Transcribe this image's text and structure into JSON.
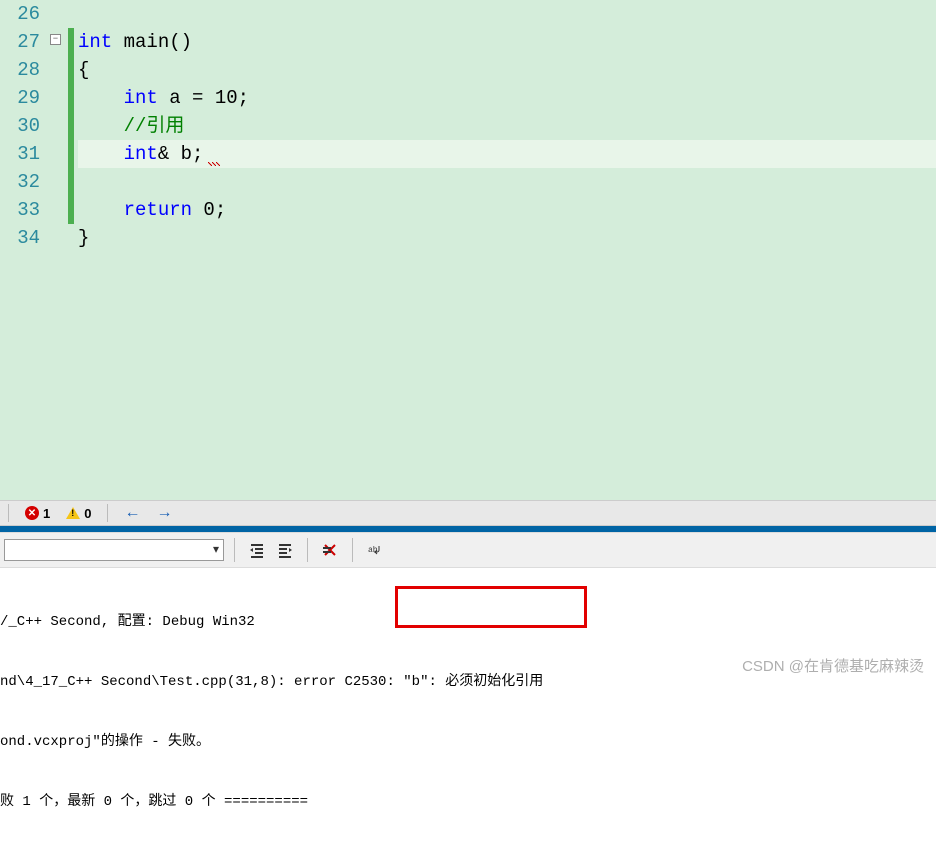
{
  "gutter": {
    "lines": [
      "26",
      "27",
      "28",
      "29",
      "30",
      "31",
      "32",
      "33",
      "34"
    ]
  },
  "code": {
    "l27_kw": "int",
    "l27_id": " main",
    "l27_p": "()",
    "l28": "{",
    "l29_kw": "int",
    "l29_rest": " a = 10;",
    "l30": "//引用",
    "l31_kw": "int",
    "l31_rest": "& b;",
    "l33_kw": "return",
    "l33_rest": " 0;",
    "l34": "}"
  },
  "statusbar": {
    "error_count": "1",
    "warning_count": "0"
  },
  "output": {
    "line1": "/_C++ Second, 配置: Debug Win32",
    "line2": "nd\\4_17_C++ Second\\Test.cpp(31,8): error C2530: \"b\": 必须初始化引用",
    "line3": "ond.vcxproj\"的操作 - 失败。",
    "line4": "败 1 个，最新 0 个，跳过 0 个 =========="
  },
  "watermark": "CSDN @在肯德基吃麻辣烫",
  "fold_marker": "−"
}
